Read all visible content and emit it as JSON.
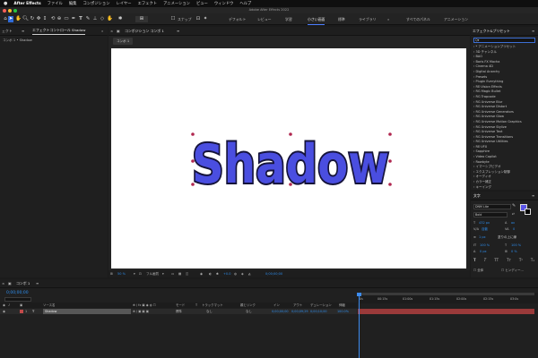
{
  "menubar": {
    "app_name": "After Effects",
    "items": [
      "ファイル",
      "編集",
      "コンポジション",
      "レイヤー",
      "エフェクト",
      "アニメーション",
      "ビュー",
      "ウィンドウ",
      "ヘルプ"
    ]
  },
  "window": {
    "title": "Adobe After Effects 2022"
  },
  "toolbar": {
    "snap_label": "スナップ",
    "workspaces": [
      {
        "label": "デフォルト",
        "active": false
      },
      {
        "label": "レビュー",
        "active": false
      },
      {
        "label": "学習",
        "active": false
      },
      {
        "label": "小さい画面",
        "active": true
      },
      {
        "label": "標準",
        "active": false
      },
      {
        "label": "ライブラリ",
        "active": false
      },
      {
        "label": "»",
        "active": false
      },
      {
        "label": "すべてのパネル",
        "active": false
      },
      {
        "label": "アニメーション",
        "active": false
      }
    ]
  },
  "left_panel": {
    "tab_partial": "ェクト",
    "tab_effects": "エフェクトコントロール Shadow",
    "breadcrumb": "コンポ 1 • Shadow"
  },
  "comp_panel": {
    "tab_label": "コンポジション コンポ 1",
    "comp_tab": "コンポ 1",
    "text": "Shadow",
    "text_color": "#4a4ee0",
    "zoom": "50 %",
    "resolution": "フル画質",
    "exposure": "+0.0",
    "timecode": "0;00;00;00"
  },
  "effects_panel": {
    "title": "エフェクト&プリセット",
    "search_placeholder": "Q▾",
    "items": [
      "* アニメーションプリセット",
      "3D チャンネル",
      "BAO",
      "Boris FX Mocha",
      "Cinema 4D",
      "Digital Anarchy",
      "Presets",
      "Plugin Everything",
      "RE:Vision Effects",
      "RG Magic Bullet",
      "RG Trapcode",
      "RG Universe Blur",
      "RG Universe Distort",
      "RG Universe Generators",
      "RG Universe Glow",
      "RG Universe Motion Graphics",
      "RG Universe Stylize",
      "RG Universe Text",
      "RG Universe Transitions",
      "RG Universe Utilities",
      "RE:VFX",
      "Sapphire",
      "Video Copilot",
      "Rowbyte",
      "イマーシブビデオ",
      "エクスプレッション制御",
      "オーディオ",
      "カラー補正",
      "キーイング"
    ]
  },
  "character_panel": {
    "title": "文字",
    "font_name": "DNM Lite",
    "font_style": "Bold",
    "font_size": "432 px",
    "leading": "ox",
    "tracking": "自動",
    "kerning": "0",
    "stroke_width": "1 px",
    "stroke_mode": "塗りの上に線",
    "vscale": "100 %",
    "hscale": "100 %",
    "baseline": "0 px",
    "tsume": "0 %",
    "color_fill": "#5b55e8",
    "opt1": "全体",
    "opt2": "ヒンディー..."
  },
  "timeline": {
    "tab_label": "コンポ 1",
    "timecode": "0;00;00;00",
    "columns": [
      "ソース名",
      "モード",
      "T",
      "トラックマット",
      "親とリンク",
      "イン",
      "アウト",
      "デュレーション",
      "伸縮"
    ],
    "layer": {
      "index": "1",
      "name": "Shadow",
      "mode": "標準",
      "track_matte": "なし",
      "parent": "なし",
      "in": "0;00;00;00",
      "out": "0;00;09;29",
      "duration": "0;00;10;00",
      "stretch": "100.0%"
    },
    "ruler": [
      "0s",
      "00:15s",
      "01:00s",
      "01:15s",
      "02:00s",
      "02:15s",
      "03:0s"
    ]
  }
}
